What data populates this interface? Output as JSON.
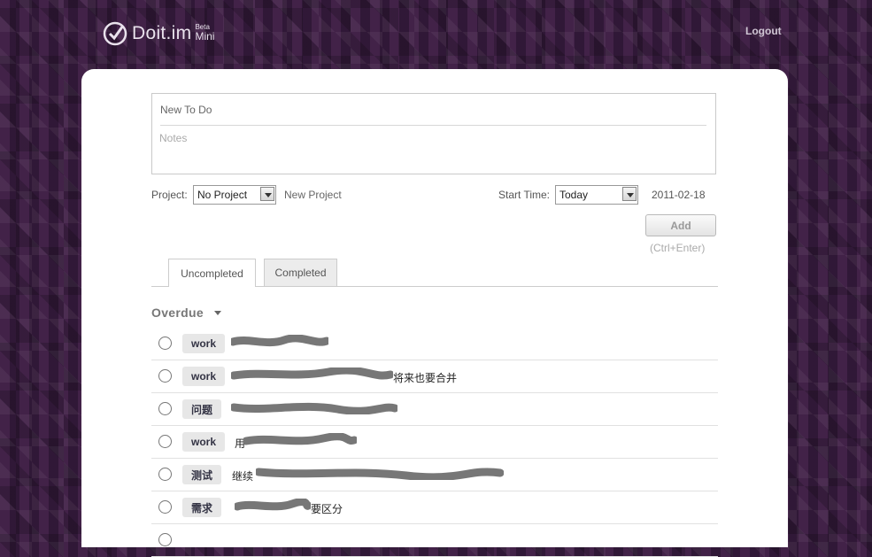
{
  "header": {
    "logo_text": "Doit.im",
    "logo_beta": "Beta",
    "logo_mini": "Mini",
    "logout_label": "Logout"
  },
  "new_todo": {
    "title_placeholder": "New To Do",
    "notes_placeholder": "Notes"
  },
  "project": {
    "label": "Project:",
    "selected": "No Project",
    "new_project_label": "New Project"
  },
  "start_time": {
    "label": "Start Time:",
    "selected": "Today",
    "date": "2011-02-18"
  },
  "add_button": {
    "label": "Add",
    "hint": "(Ctrl+Enter)"
  },
  "tabs": [
    {
      "label": "Uncompleted",
      "active": true
    },
    {
      "label": "Completed",
      "active": false
    }
  ],
  "section": {
    "title": "Overdue"
  },
  "tasks": [
    {
      "tag": "work",
      "text": ""
    },
    {
      "tag": "work",
      "text": "将来也要合并"
    },
    {
      "tag": "问题",
      "text": ""
    },
    {
      "tag": "work",
      "text": "用"
    },
    {
      "tag": "测试",
      "text": "继续"
    },
    {
      "tag": "需求",
      "text": "要区分"
    }
  ],
  "colors": {
    "background": "#3a1f3f",
    "panel": "#ffffff",
    "tag_bg": "#e7e7e7"
  }
}
